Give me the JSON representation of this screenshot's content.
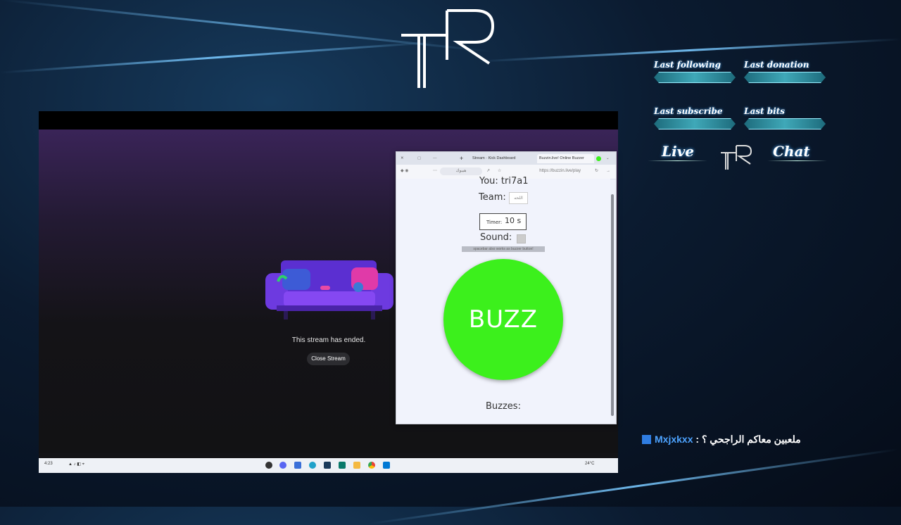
{
  "overlay": {
    "logo_text": "TR",
    "stats": [
      {
        "label": "Last following"
      },
      {
        "label": "Last donation"
      },
      {
        "label": "Last subscribe"
      },
      {
        "label": "Last bits"
      }
    ],
    "live_label": "Live",
    "chat_label": "Chat",
    "chat": {
      "user": "Mxjxkxx",
      "separator": " : ",
      "message": "ملعبين معاكم الراجحي ؟"
    }
  },
  "stream": {
    "ended_text": "This stream has ended.",
    "close_button": "Close Stream"
  },
  "browser": {
    "tabs": [
      "Stream · Kick Dashboard",
      "Buzzin.live! Online Buzzer"
    ],
    "profile_label": "هيبوك",
    "url": "https://buzzin.live/play",
    "you_label": "You: tri7a1",
    "team_label": "Team:",
    "team_value": "اللحه",
    "timer_label": "Timer:",
    "timer_value": "10 s",
    "sound_label": "Sound:",
    "hint": "spacebar also works as buzzer button!",
    "buzz_label": "BUZZ",
    "buzzes_label": "Buzzes:"
  },
  "taskbar": {
    "weather": "24°C",
    "time": "4:23"
  },
  "colors": {
    "buzz": "#3cf01c",
    "accent": "#3fa8b8",
    "chat_user": "#4da3ff"
  }
}
